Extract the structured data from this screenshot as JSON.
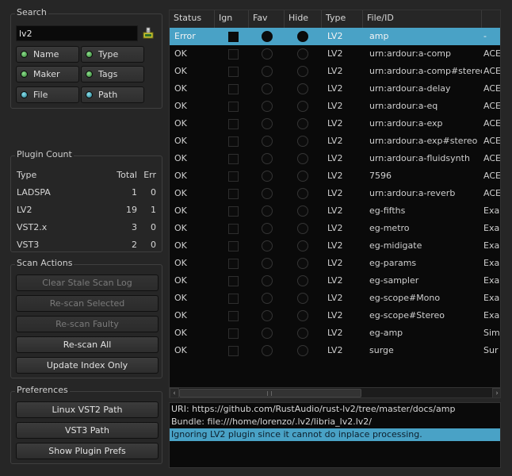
{
  "search": {
    "title": "Search",
    "value": "lv2",
    "filters": [
      {
        "label": "Name",
        "led": "green"
      },
      {
        "label": "Type",
        "led": "green"
      },
      {
        "label": "Maker",
        "led": "green"
      },
      {
        "label": "Tags",
        "led": "green"
      },
      {
        "label": "File",
        "led": "cyan"
      },
      {
        "label": "Path",
        "led": "cyan"
      }
    ]
  },
  "plugin_count": {
    "title": "Plugin Count",
    "headers": {
      "type": "Type",
      "total": "Total",
      "err": "Err"
    },
    "rows": [
      {
        "type": "LADSPA",
        "total": "1",
        "err": "0"
      },
      {
        "type": "LV2",
        "total": "19",
        "err": "1"
      },
      {
        "type": "VST2.x",
        "total": "3",
        "err": "0"
      },
      {
        "type": "VST3",
        "total": "2",
        "err": "0"
      }
    ]
  },
  "scan_actions": {
    "title": "Scan Actions",
    "clear_stale": "Clear Stale Scan Log",
    "rescan_selected": "Re-scan Selected",
    "rescan_faulty": "Re-scan Faulty",
    "rescan_all": "Re-scan All",
    "update_index": "Update Index Only"
  },
  "preferences": {
    "title": "Preferences",
    "linux_vst2": "Linux VST2 Path",
    "vst3": "VST3 Path",
    "show_prefs": "Show Plugin Prefs"
  },
  "list": {
    "headers": [
      "Status",
      "Ign",
      "Fav",
      "Hide",
      "Type",
      "File/ID"
    ],
    "rows": [
      {
        "status": "Error",
        "ign": true,
        "fav": true,
        "hide": true,
        "type": "LV2",
        "file": "amp",
        "extra": "-",
        "selected": true
      },
      {
        "status": "OK",
        "ign": false,
        "fav": false,
        "hide": false,
        "type": "LV2",
        "file": "urn:ardour:a-comp",
        "extra": "ACE"
      },
      {
        "status": "OK",
        "ign": false,
        "fav": false,
        "hide": false,
        "type": "LV2",
        "file": "urn:ardour:a-comp#stereo",
        "extra": "ACE"
      },
      {
        "status": "OK",
        "ign": false,
        "fav": false,
        "hide": false,
        "type": "LV2",
        "file": "urn:ardour:a-delay",
        "extra": "ACE"
      },
      {
        "status": "OK",
        "ign": false,
        "fav": false,
        "hide": false,
        "type": "LV2",
        "file": "urn:ardour:a-eq",
        "extra": "ACE"
      },
      {
        "status": "OK",
        "ign": false,
        "fav": false,
        "hide": false,
        "type": "LV2",
        "file": "urn:ardour:a-exp",
        "extra": "ACE"
      },
      {
        "status": "OK",
        "ign": false,
        "fav": false,
        "hide": false,
        "type": "LV2",
        "file": "urn:ardour:a-exp#stereo",
        "extra": "ACE"
      },
      {
        "status": "OK",
        "ign": false,
        "fav": false,
        "hide": false,
        "type": "LV2",
        "file": "urn:ardour:a-fluidsynth",
        "extra": "ACE"
      },
      {
        "status": "OK",
        "ign": false,
        "fav": false,
        "hide": false,
        "type": "LV2",
        "file": "7596",
        "extra": "ACE"
      },
      {
        "status": "OK",
        "ign": false,
        "fav": false,
        "hide": false,
        "type": "LV2",
        "file": "urn:ardour:a-reverb",
        "extra": "ACE"
      },
      {
        "status": "OK",
        "ign": false,
        "fav": false,
        "hide": false,
        "type": "LV2",
        "file": "eg-fifths",
        "extra": "Exa"
      },
      {
        "status": "OK",
        "ign": false,
        "fav": false,
        "hide": false,
        "type": "LV2",
        "file": "eg-metro",
        "extra": "Exa"
      },
      {
        "status": "OK",
        "ign": false,
        "fav": false,
        "hide": false,
        "type": "LV2",
        "file": "eg-midigate",
        "extra": "Exa"
      },
      {
        "status": "OK",
        "ign": false,
        "fav": false,
        "hide": false,
        "type": "LV2",
        "file": "eg-params",
        "extra": "Exa"
      },
      {
        "status": "OK",
        "ign": false,
        "fav": false,
        "hide": false,
        "type": "LV2",
        "file": "eg-sampler",
        "extra": "Exa"
      },
      {
        "status": "OK",
        "ign": false,
        "fav": false,
        "hide": false,
        "type": "LV2",
        "file": "eg-scope#Mono",
        "extra": "Exa"
      },
      {
        "status": "OK",
        "ign": false,
        "fav": false,
        "hide": false,
        "type": "LV2",
        "file": "eg-scope#Stereo",
        "extra": "Exa"
      },
      {
        "status": "OK",
        "ign": false,
        "fav": false,
        "hide": false,
        "type": "LV2",
        "file": "eg-amp",
        "extra": "Sim"
      },
      {
        "status": "OK",
        "ign": false,
        "fav": false,
        "hide": false,
        "type": "LV2",
        "file": "surge",
        "extra": "Sur"
      }
    ]
  },
  "info": {
    "uri": "URI: https://github.com/RustAudio/rust-lv2/tree/master/docs/amp",
    "bundle": "Bundle: file:///home/lorenzo/.lv2/libria_lv2.lv2/",
    "message": "Ignoring LV2 plugin since it cannot do inplace processing."
  },
  "colors": {
    "selection": "#49a2c6",
    "background": "#262626",
    "list_background": "#0a0a0a"
  }
}
